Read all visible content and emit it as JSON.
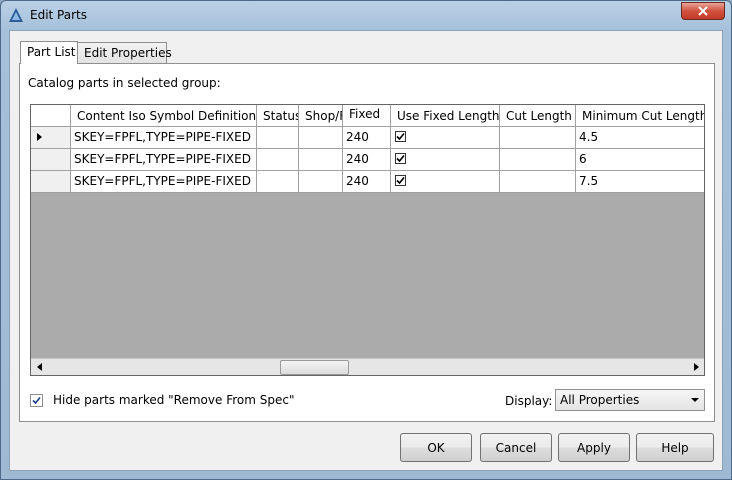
{
  "window": {
    "title": "Edit Parts"
  },
  "tabs": [
    {
      "label": "Part List",
      "active": true
    },
    {
      "label": "Edit Properties",
      "active": false
    }
  ],
  "caption": "Catalog parts in selected group:",
  "table": {
    "columns": [
      "Content Iso Symbol Definition",
      "Status",
      "Shop/F",
      "Fixed",
      "Use Fixed Length",
      "Cut Length",
      "Minimum Cut Length"
    ],
    "rows": [
      {
        "current": true,
        "cells": [
          "SKEY=FPFL,TYPE=PIPE-FIXED",
          "",
          "",
          "240",
          true,
          "",
          "4.5"
        ]
      },
      {
        "current": false,
        "cells": [
          "SKEY=FPFL,TYPE=PIPE-FIXED",
          "",
          "",
          "240",
          true,
          "",
          "6"
        ]
      },
      {
        "current": false,
        "cells": [
          "SKEY=FPFL,TYPE=PIPE-FIXED",
          "",
          "",
          "240",
          true,
          "",
          "7.5"
        ]
      }
    ]
  },
  "hide_parts": {
    "label": "Hide parts marked \"Remove From Spec\"",
    "checked": true
  },
  "display": {
    "label": "Display:",
    "value": "All Properties"
  },
  "buttons": {
    "ok": "OK",
    "cancel": "Cancel",
    "apply": "Apply",
    "help": "Help"
  },
  "icons": {
    "app": "autocad-plant-icon",
    "close": "close-icon"
  },
  "colors": {
    "grid_empty": "#ababab",
    "close_button": "#c8432e",
    "title_bar": "#a9c3dc"
  }
}
